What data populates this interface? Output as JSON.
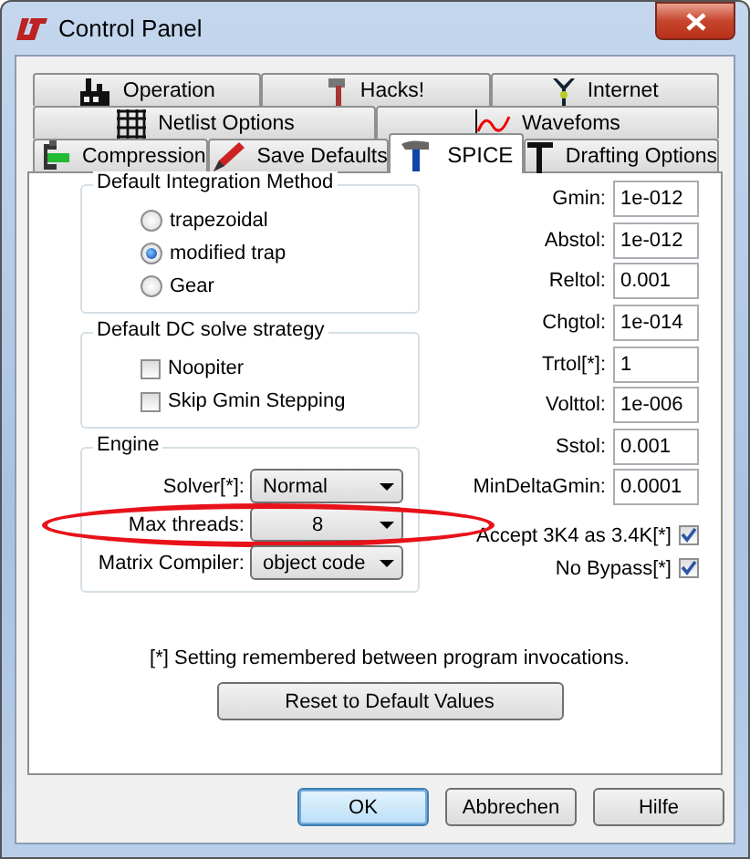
{
  "window": {
    "title": "Control Panel"
  },
  "tab_rows": [
    {
      "tabs": [
        {
          "label": "Operation",
          "selected": false
        },
        {
          "label": "Hacks!",
          "selected": false
        },
        {
          "label": "Internet",
          "selected": false
        }
      ]
    },
    {
      "tabs": [
        {
          "label": "Netlist Options",
          "selected": false
        },
        {
          "label": "Wavefoms",
          "selected": false
        }
      ]
    },
    {
      "tabs": [
        {
          "label": "Compression",
          "selected": false
        },
        {
          "label": "Save Defaults",
          "selected": false
        },
        {
          "label": "SPICE",
          "selected": true
        },
        {
          "label": "Drafting Options",
          "selected": false
        }
      ]
    }
  ],
  "integration_method": {
    "title": "Default Integration Method",
    "options": [
      {
        "label": "trapezoidal",
        "selected": false
      },
      {
        "label": "modified trap",
        "selected": true
      },
      {
        "label": "Gear",
        "selected": false
      }
    ]
  },
  "dc_strategy": {
    "title": "Default DC solve strategy",
    "options": [
      {
        "label": "Noopiter",
        "checked": false
      },
      {
        "label": "Skip Gmin Stepping",
        "checked": false
      }
    ]
  },
  "engine": {
    "title": "Engine",
    "rows": [
      {
        "label": "Solver[*]:",
        "value": "Normal",
        "kind": "text",
        "highlighted": false
      },
      {
        "label": "Max threads:",
        "value": "8",
        "kind": "number",
        "highlighted": true
      },
      {
        "label": "Matrix Compiler:",
        "value": "object code",
        "kind": "text",
        "highlighted": false
      }
    ]
  },
  "tolerances": [
    {
      "label": "Gmin:",
      "value": "1e-012"
    },
    {
      "label": "Abstol:",
      "value": "1e-012"
    },
    {
      "label": "Reltol:",
      "value": "0.001"
    },
    {
      "label": "Chgtol:",
      "value": "1e-014"
    },
    {
      "label": "Trtol[*]:",
      "value": "1"
    },
    {
      "label": "Volttol:",
      "value": "1e-006"
    },
    {
      "label": "Sstol:",
      "value": "0.001"
    },
    {
      "label": "MinDeltaGmin:",
      "value": "0.0001"
    }
  ],
  "flags": [
    {
      "label": "Accept 3K4 as 3.4K[*]",
      "checked": true
    },
    {
      "label": "No Bypass[*]",
      "checked": true
    }
  ],
  "note": "[*] Setting remembered between program invocations.",
  "reset_button": "Reset to Default Values",
  "buttons": [
    {
      "label": "OK",
      "default": true
    },
    {
      "label": "Abbrechen",
      "default": false
    },
    {
      "label": "Hilfe",
      "default": false
    }
  ]
}
